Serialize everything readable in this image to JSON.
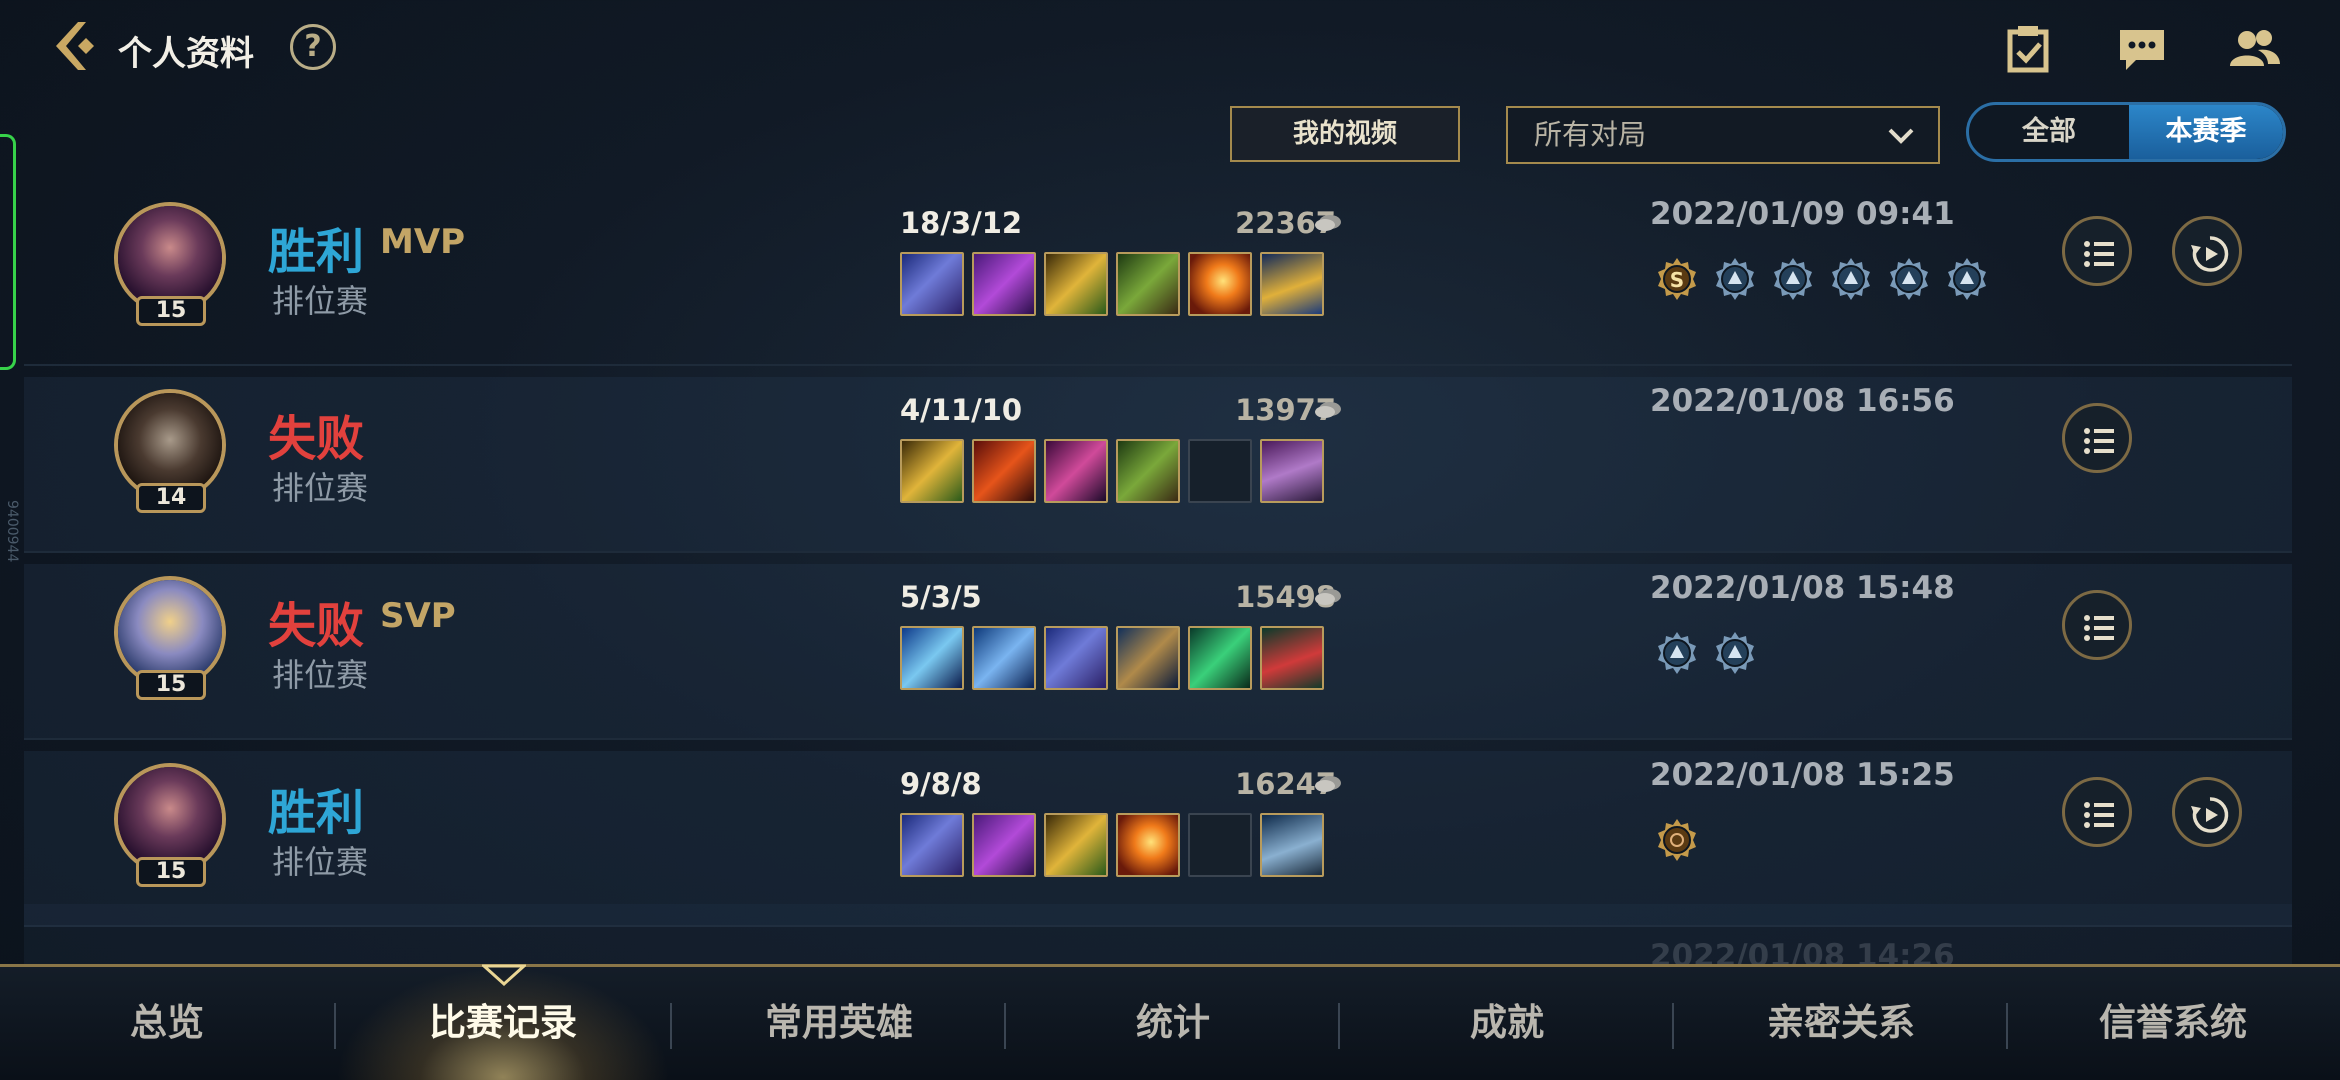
{
  "header": {
    "title": "个人资料",
    "help_symbol": "?"
  },
  "edge_vertical_text": "9400944",
  "filters": {
    "my_videos_label": "我的视频",
    "match_filter_value": "所有对局",
    "season_toggle": {
      "all_label": "全部",
      "season_label": "本赛季",
      "selected": "本赛季"
    }
  },
  "matches": [
    {
      "result": "胜利",
      "outcome": "win",
      "tag": "MVP",
      "mode": "排位赛",
      "level": "15",
      "kda": "18/3/12",
      "gold": "22367",
      "date": "2022/01/09 09:41",
      "has_replay": true,
      "items": [
        "blue-blade",
        "purple-staff",
        "gold-saber",
        "green-crossbow",
        "flame-orb",
        "gold-cup-active"
      ],
      "medals": [
        "s-rank-medal",
        "flag-medal",
        "scroll-medal",
        "crown-medal",
        "split-medal",
        "shield-medal"
      ]
    },
    {
      "result": "失败",
      "outcome": "loss",
      "tag": "",
      "mode": "排位赛",
      "level": "14",
      "kda": "4/11/10",
      "gold": "13977",
      "date": "2022/01/08 16:56",
      "has_replay": false,
      "items": [
        "gold-saber",
        "red-greatsword",
        "pink-spear",
        "green-crossbow",
        "empty",
        "purple-boots-active"
      ],
      "medals": []
    },
    {
      "result": "失败",
      "outcome": "loss",
      "tag": "SVP",
      "mode": "排位赛",
      "level": "15",
      "kda": "5/3/5",
      "gold": "15498",
      "date": "2022/01/08 15:48",
      "has_replay": false,
      "items": [
        "blue-sword",
        "ice-fist",
        "blue-blade",
        "bronze-dagger",
        "green-lance",
        "red-boots-active"
      ],
      "medals": [
        "scroll-medal",
        "crown-medal"
      ]
    },
    {
      "result": "胜利",
      "outcome": "win",
      "tag": "",
      "mode": "排位赛",
      "level": "15",
      "kda": "9/8/8",
      "gold": "16247",
      "date": "2022/01/08 15:25",
      "has_replay": true,
      "items": [
        "blue-blade",
        "purple-staff",
        "gold-saber",
        "flame-orb",
        "empty",
        "steel-boots-active"
      ],
      "medals": [
        "bronze-target-medal"
      ]
    }
  ],
  "faded_next_date": "2022/01/08 14:26",
  "bottom_nav": [
    {
      "label": "总览",
      "active": false
    },
    {
      "label": "比赛记录",
      "active": true
    },
    {
      "label": "常用英雄",
      "active": false
    },
    {
      "label": "统计",
      "active": false
    },
    {
      "label": "成就",
      "active": false
    },
    {
      "label": "亲密关系",
      "active": false
    },
    {
      "label": "信誉系统",
      "active": false
    }
  ],
  "colors": {
    "win": "#2ea6d6",
    "loss": "#e2413d",
    "gold_accent": "#b89b5c",
    "toggle_active": "#2c86c9",
    "edge_accent": "#37d24a"
  }
}
